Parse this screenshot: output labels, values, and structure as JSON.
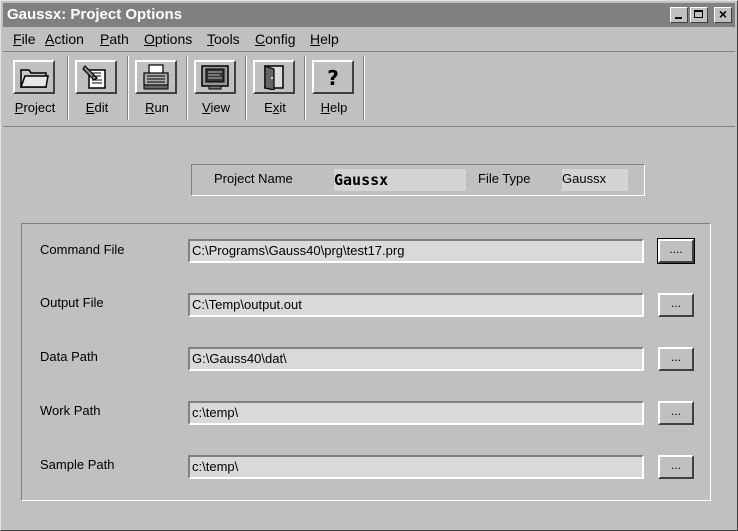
{
  "window": {
    "title": "Gaussx: Project Options"
  },
  "menu": [
    {
      "u": "F",
      "rest": "ile"
    },
    {
      "u": "A",
      "rest": "ction"
    },
    {
      "u": "P",
      "rest": "ath"
    },
    {
      "u": "O",
      "rest": "ptions"
    },
    {
      "u": "T",
      "rest": "ools"
    },
    {
      "u": "C",
      "rest": "onfig"
    },
    {
      "u": "H",
      "rest": "elp"
    }
  ],
  "toolbar": [
    {
      "u": "P",
      "rest": "roject",
      "icon": "folder-icon"
    },
    {
      "u": "E",
      "rest": "dit",
      "icon": "edit-icon"
    },
    {
      "u": "R",
      "rest": "un",
      "icon": "printer-icon"
    },
    {
      "u": "V",
      "rest": "iew",
      "icon": "monitor-icon"
    },
    {
      "pre": "E",
      "u": "x",
      "rest": "it",
      "icon": "door-icon"
    },
    {
      "u": "H",
      "rest": "elp",
      "icon": "question-icon"
    }
  ],
  "project": {
    "name_label": "Project Name",
    "name_value": "Gaussx",
    "type_label": "File Type",
    "type_value": "Gaussx"
  },
  "paths": [
    {
      "label": "Command File",
      "value": "C:\\Programs\\Gauss40\\prg\\test17.prg",
      "browse": "...."
    },
    {
      "label": "Output File",
      "value": "C:\\Temp\\output.out",
      "browse": "..."
    },
    {
      "label": "Data Path",
      "value": "G:\\Gauss40\\dat\\",
      "browse": "..."
    },
    {
      "label": "Work Path",
      "value": "c:\\temp\\",
      "browse": "..."
    },
    {
      "label": "Sample Path",
      "value": "c:\\temp\\",
      "browse": "..."
    }
  ]
}
